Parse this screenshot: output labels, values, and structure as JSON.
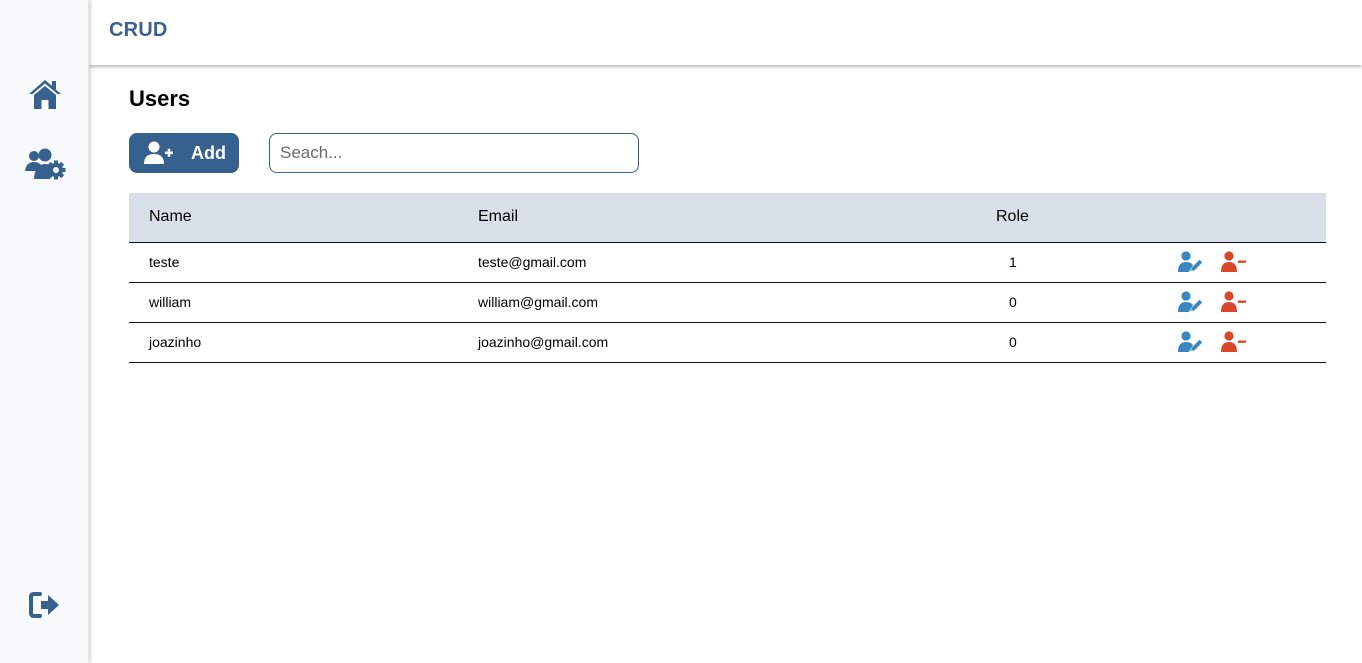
{
  "app": {
    "title": "CRUD"
  },
  "sidebar": {
    "items": [
      {
        "icon": "home-icon"
      },
      {
        "icon": "users-gear-icon"
      },
      {
        "icon": "logout-icon"
      }
    ]
  },
  "page": {
    "title": "Users"
  },
  "toolbar": {
    "add_label": "Add",
    "add_icon": "user-plus-icon",
    "search_placeholder": "Seach..."
  },
  "table": {
    "columns": [
      "Name",
      "Email",
      "Role"
    ],
    "rows": [
      {
        "name": "teste",
        "email": "teste@gmail.com",
        "role": "1"
      },
      {
        "name": "william",
        "email": "william@gmail.com",
        "role": "0"
      },
      {
        "name": "joazinho",
        "email": "joazinho@gmail.com",
        "role": "0"
      }
    ],
    "row_actions": {
      "edit_icon": "user-edit-icon",
      "delete_icon": "user-minus-icon"
    }
  },
  "colors": {
    "primary": "#36608d",
    "brand_text": "#3c6190",
    "header_bg": "#d8dfe8",
    "edit": "#3a87be",
    "delete": "#d9482b",
    "sidebar_bg": "#f7f9fb"
  }
}
